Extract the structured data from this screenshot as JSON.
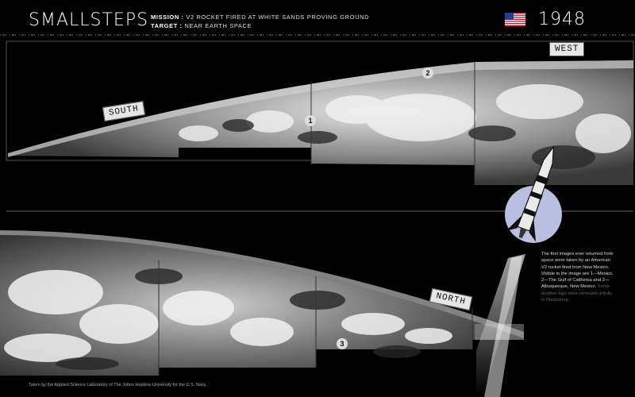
{
  "header": {
    "brand": "SMALLSTEPS",
    "mission_label": "MISSION :",
    "mission_value": "V2 ROCKET FIRED AT WHITE SANDS PROVING GROUND",
    "target_label": "TARGET :",
    "target_value": "NEAR EARTH SPACE",
    "year": "1948"
  },
  "labels": {
    "south": "SOUTH",
    "west": "WEST",
    "north": "NORTH"
  },
  "markers": [
    "1",
    "2",
    "3"
  ],
  "caption": {
    "main": "The first images ever returned from space were taken by an American V2 rocket fired from New Mexico. Visible in the image are 1—Mexico, 2—The Gulf of California and 3—Albuquerque, New Mexico.",
    "note": "Some number tags were removed artfully in Photoshop."
  },
  "credit": "Taken by the Applied Science Laboratory of The Johns Hopkins University for the U.S. Navy.",
  "colors": {
    "background": "#000000",
    "tag": "#e6e6e6",
    "moon": "#b9bfe0"
  }
}
